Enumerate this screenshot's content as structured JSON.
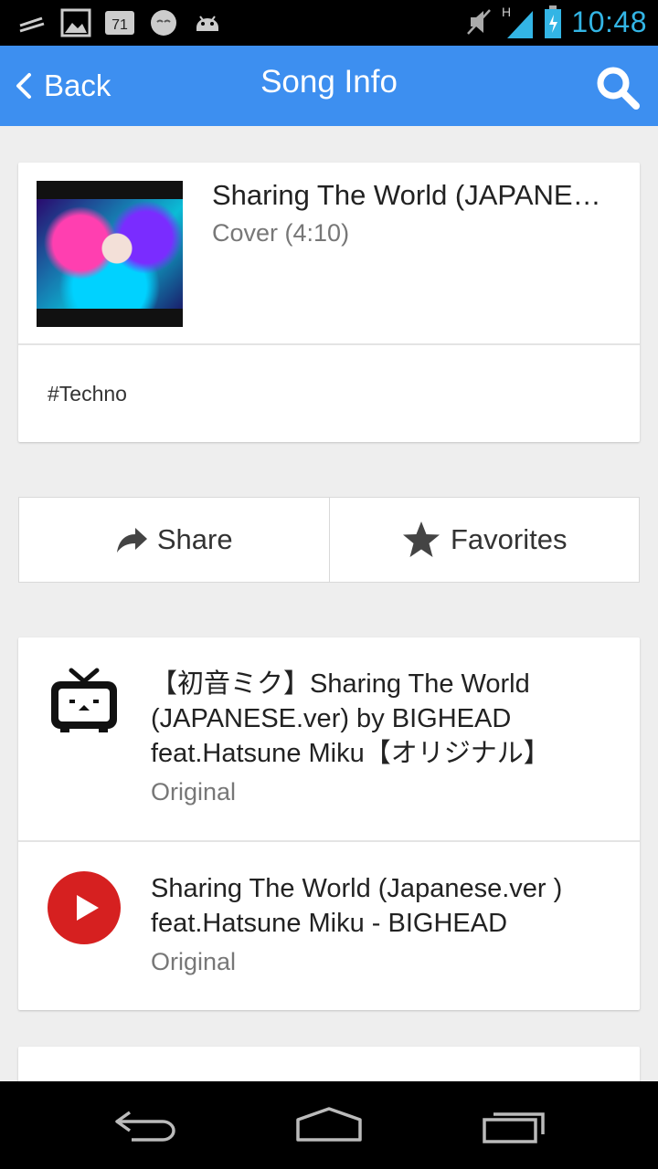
{
  "status_bar": {
    "time": "10:48",
    "left_icons": [
      "notification-icon",
      "image-icon",
      "temperature-icon",
      "emoji-icon",
      "android-icon"
    ],
    "temperature_badge": "71",
    "network_label": "H",
    "accent_color": "#33b5e5"
  },
  "app_bar": {
    "back_label": "Back",
    "title": "Song Info",
    "color": "#3d8ff0"
  },
  "song": {
    "title": "Sharing The World (JAPANESE.ver)",
    "subtitle": "Cover (4:10)",
    "tag": "#Techno"
  },
  "actions": {
    "share_label": "Share",
    "favorites_label": "Favorites"
  },
  "sources": [
    {
      "icon": "niconico-tv-icon",
      "title": "【初音ミク】Sharing The World (JAPANESE.ver) by BIGHEAD feat.Hatsune Miku【オリジナル】",
      "subtitle": "Original"
    },
    {
      "icon": "youtube-play-icon",
      "title": "Sharing The World (Japanese.ver ) feat.Hatsune Miku - BIGHEAD",
      "subtitle": "Original"
    }
  ]
}
